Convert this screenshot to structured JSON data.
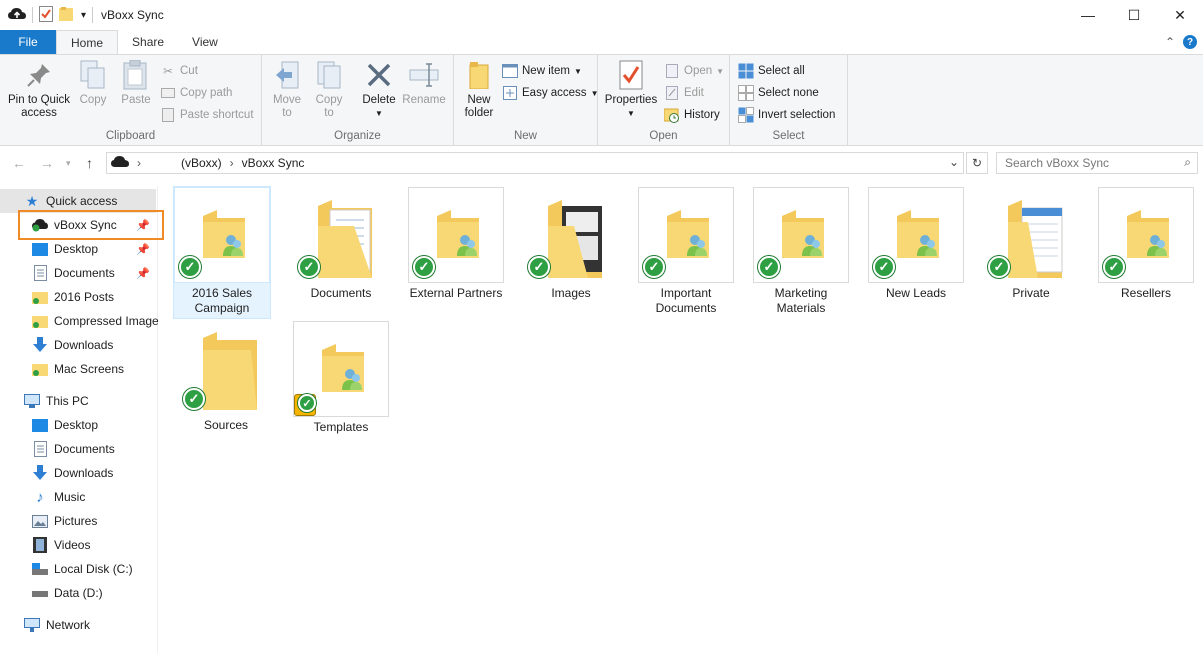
{
  "window": {
    "title": "vBoxx Sync",
    "controls": {
      "minimize": "—",
      "maximize": "☐",
      "close": "✕"
    }
  },
  "tabs": {
    "file": "File",
    "home": "Home",
    "share": "Share",
    "view": "View"
  },
  "ribbon": {
    "clipboard": {
      "label": "Clipboard",
      "pin_line1": "Pin to Quick",
      "pin_line2": "access",
      "copy": "Copy",
      "paste": "Paste",
      "cut": "Cut",
      "copy_path": "Copy path",
      "paste_shortcut": "Paste shortcut"
    },
    "organize": {
      "label": "Organize",
      "move_line1": "Move",
      "move_line2": "to",
      "copy_line1": "Copy",
      "copy_line2": "to",
      "delete": "Delete",
      "rename": "Rename"
    },
    "new": {
      "label": "New",
      "folder_line1": "New",
      "folder_line2": "folder",
      "new_item": "New item",
      "easy_access": "Easy access"
    },
    "open": {
      "label": "Open",
      "properties": "Properties",
      "open": "Open",
      "edit": "Edit",
      "history": "History"
    },
    "select": {
      "label": "Select",
      "select_all": "Select all",
      "select_none": "Select none",
      "invert": "Invert selection"
    }
  },
  "address": {
    "crumb1": "(vBoxx)",
    "crumb2": "vBoxx Sync",
    "search_placeholder": "Search vBoxx Sync"
  },
  "nav": {
    "quick_access": "Quick access",
    "vboxx_sync": "vBoxx Sync",
    "desktop": "Desktop",
    "documents": "Documents",
    "posts": "2016 Posts",
    "compressed": "Compressed Image",
    "downloads": "Downloads",
    "mac_screens": "Mac Screens",
    "this_pc": "This PC",
    "pc_desktop": "Desktop",
    "pc_documents": "Documents",
    "pc_downloads": "Downloads",
    "music": "Music",
    "pictures": "Pictures",
    "videos": "Videos",
    "local_disk": "Local Disk (C:)",
    "data": "Data (D:)",
    "network": "Network"
  },
  "folders": [
    {
      "line1": "2016 Sales",
      "line2": "Campaign"
    },
    {
      "line1": "Documents",
      "line2": ""
    },
    {
      "line1": "External Partners",
      "line2": ""
    },
    {
      "line1": "Images",
      "line2": ""
    },
    {
      "line1": "Important",
      "line2": "Documents"
    },
    {
      "line1": "Marketing",
      "line2": "Materials"
    },
    {
      "line1": "New Leads",
      "line2": ""
    },
    {
      "line1": "Private",
      "line2": ""
    },
    {
      "line1": "Resellers",
      "line2": ""
    },
    {
      "line1": "Sources",
      "line2": ""
    },
    {
      "line1": "Templates",
      "line2": ""
    }
  ]
}
